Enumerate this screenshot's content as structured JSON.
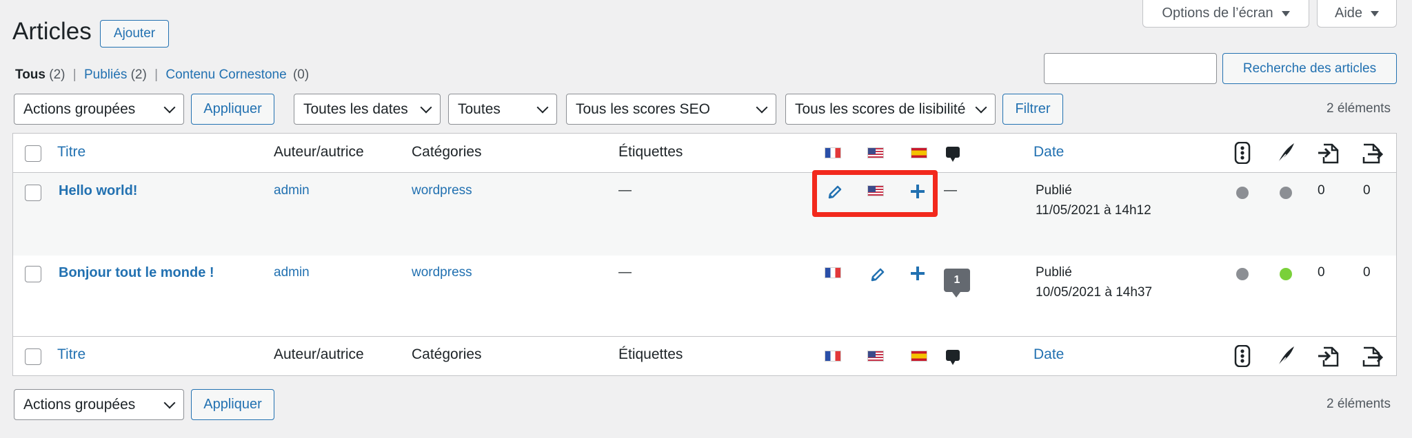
{
  "screen_tabs": {
    "options_label": "Options de l’écran",
    "help_label": "Aide"
  },
  "header": {
    "title": "Articles",
    "add_label": "Ajouter"
  },
  "views": [
    {
      "label": "Tous",
      "count": "(2)"
    },
    {
      "label": "Publiés",
      "count": "(2)"
    },
    {
      "label": "Contenu Cornestone",
      "count": "(0)"
    }
  ],
  "search": {
    "value": "",
    "button_label": "Recherche des articles"
  },
  "filters": {
    "bulk_action": "Actions groupées",
    "apply_label": "Appliquer",
    "dates": "Toutes les dates",
    "categories": "Toutes",
    "seo_scores": "Tous les scores SEO",
    "readability": "Tous les scores de lisibilité",
    "filter_label": "Filtrer",
    "count": "2 éléments"
  },
  "columns": {
    "title": "Titre",
    "author": "Auteur/autrice",
    "categories": "Catégories",
    "tags": "Étiquettes",
    "date": "Date"
  },
  "rows": [
    {
      "title": "Hello world!",
      "author": "admin",
      "category": "wordpress",
      "tags": "—",
      "comments": "—",
      "status": "Publié",
      "date": "11/05/2021 à 14h12",
      "seo_color": "#8c8f94",
      "readability_color": "#8c8f94",
      "links_out": "0",
      "links_in": "0"
    },
    {
      "title": "Bonjour tout le monde !",
      "author": "admin",
      "category": "wordpress",
      "tags": "—",
      "comments": "1",
      "status": "Publié",
      "date": "10/05/2021 à 14h37",
      "seo_color": "#8c8f94",
      "readability_color": "#7ad03a",
      "links_out": "0",
      "links_in": "0"
    }
  ],
  "bottom": {
    "bulk_action": "Actions groupées",
    "apply_label": "Appliquer",
    "count": "2 éléments"
  },
  "colors": {
    "accent": "#2271b1",
    "highlight": "#f2291d",
    "background": "#f0f0f1"
  }
}
